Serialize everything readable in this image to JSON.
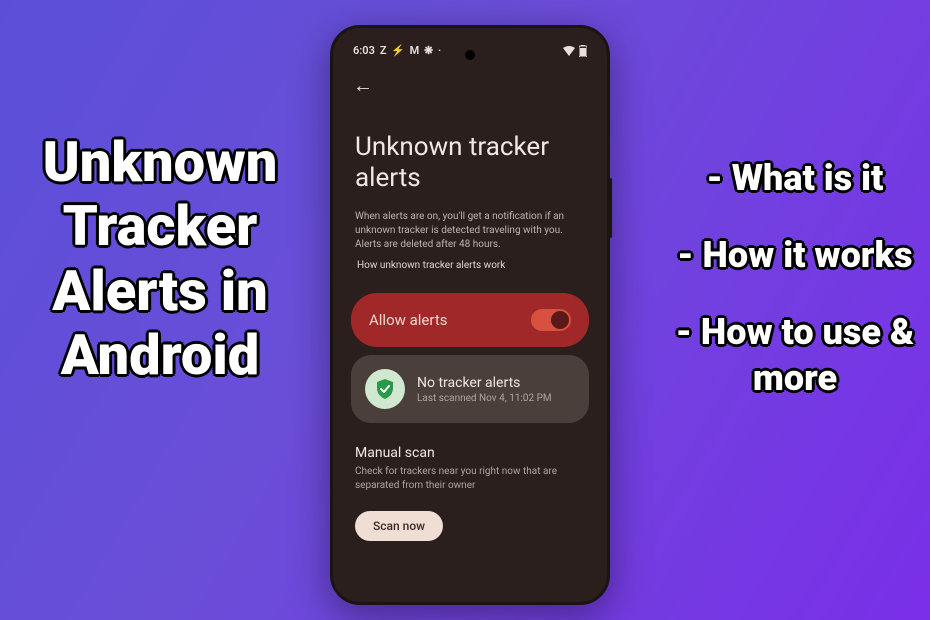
{
  "left_title": "Unknown Tracker Alerts in Android",
  "right_items": [
    "- What is it",
    "- How it works",
    "- How to use & more"
  ],
  "status_bar": {
    "time": "6:03",
    "indicators": "Z ⚡ M ❋ ·"
  },
  "header": {
    "back_glyph": "←"
  },
  "page": {
    "title": "Unknown tracker alerts",
    "description": "When alerts are on, you'll get a notification if an unknown tracker is detected traveling with you. Alerts are deleted after 48 hours.",
    "how_link": "How unknown tracker alerts work"
  },
  "allow_card": {
    "label": "Allow alerts",
    "enabled": true
  },
  "status_card": {
    "title": "No tracker alerts",
    "subtitle": "Last scanned Nov 4, 11:02 PM"
  },
  "manual": {
    "title": "Manual scan",
    "description": "Check for trackers near you right now that are separated from their owner",
    "button": "Scan now"
  }
}
